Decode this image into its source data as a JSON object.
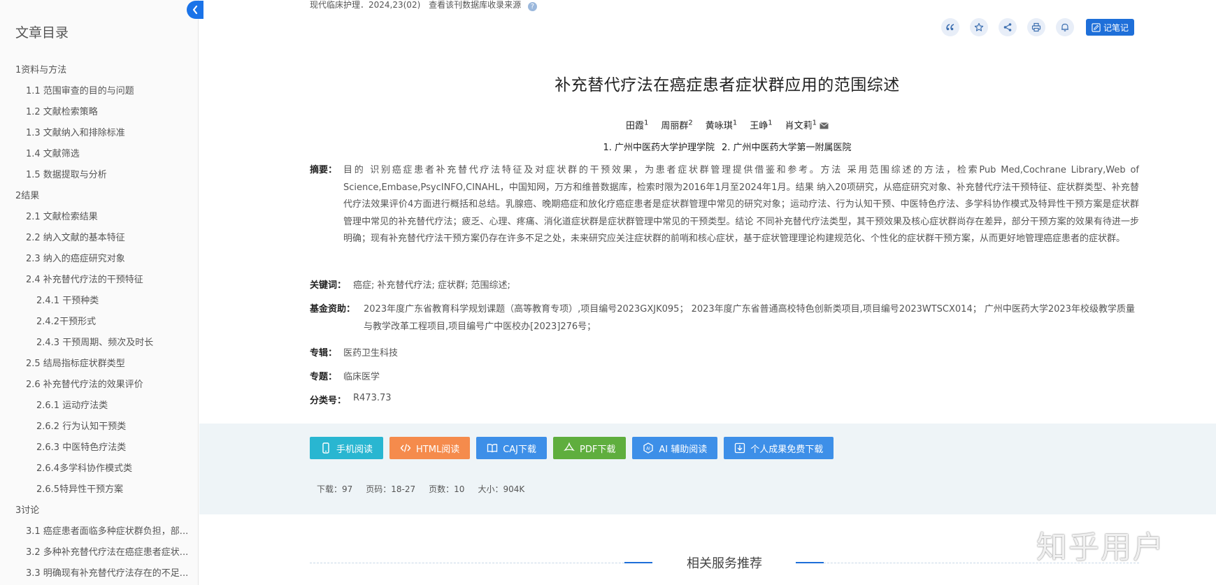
{
  "sidebar": {
    "title": "文章目录",
    "toc": [
      {
        "label": "1资料与方法",
        "level": 1
      },
      {
        "label": "1.1 范围审查的目的与问题",
        "level": 2
      },
      {
        "label": "1.2 文献检索策略",
        "level": 2
      },
      {
        "label": "1.3 文献纳入和排除标准",
        "level": 2
      },
      {
        "label": "1.4 文献筛选",
        "level": 2
      },
      {
        "label": "1.5 数据提取与分析",
        "level": 2
      },
      {
        "label": "2结果",
        "level": 1
      },
      {
        "label": "2.1 文献检索结果",
        "level": 2
      },
      {
        "label": "2.2 纳入文献的基本特征",
        "level": 2
      },
      {
        "label": "2.3 纳入的癌症研究对象",
        "level": 2
      },
      {
        "label": "2.4 补充替代疗法的干预特征",
        "level": 2
      },
      {
        "label": "2.4.1 干预种类",
        "level": 3
      },
      {
        "label": "2.4.2干预形式",
        "level": 3
      },
      {
        "label": "2.4.3 干预周期、频次及时长",
        "level": 3
      },
      {
        "label": "2.5 结局指标症状群类型",
        "level": 2
      },
      {
        "label": "2.6 补充替代疗法的效果评价",
        "level": 2
      },
      {
        "label": "2.6.1 运动疗法类",
        "level": 3
      },
      {
        "label": "2.6.2 行为认知干预类",
        "level": 3
      },
      {
        "label": "2.6.3 中医特色疗法类",
        "level": 3
      },
      {
        "label": "2.6.4多学科协作模式类",
        "level": 3
      },
      {
        "label": "2.6.5特异性干预方案",
        "level": 3
      },
      {
        "label": "3讨论",
        "level": 1
      },
      {
        "label": "3.1 癌症患者面临多种症状群负担，部...",
        "level": 2
      },
      {
        "label": "3.2 多种补充替代疗法在癌症患者症状...",
        "level": 2
      },
      {
        "label": "3.3 明确现有补充替代疗法存在的不足...",
        "level": 2
      }
    ]
  },
  "source": {
    "journal": "现代临床护理．2024,23(02)",
    "link_text": "查看该刊数据库收录来源"
  },
  "toolbar": {
    "icons": [
      "quote-icon",
      "star-icon",
      "share-icon",
      "print-icon",
      "bell-icon"
    ],
    "note_label": "记笔记"
  },
  "article": {
    "title": "补充替代疗法在癌症患者症状群应用的范围综述",
    "authors": [
      {
        "name": "田霞",
        "aff": "1"
      },
      {
        "name": "周丽群",
        "aff": "2"
      },
      {
        "name": "黄咏琪",
        "aff": "1"
      },
      {
        "name": "王峥",
        "aff": "1"
      },
      {
        "name": "肖文莉",
        "aff": "1"
      }
    ],
    "orgs": [
      "1. 广州中医药大学护理学院",
      "2. 广州中医药大学第一附属医院"
    ],
    "abstract_label": "摘要：",
    "abstract": "目的 识别癌症患者补充替代疗法特征及对症状群的干预效果，为患者症状群管理提供借鉴和参考。方法 采用范围综述的方法，检索Pub Med,Cochrane Library,Web of Science,Embase,PsycINFO,CINAHL，中国知网，万方和维普数据库，检索时限为2016年1月至2024年1月。结果 纳入20项研究，从癌症研究对象、补充替代疗法干预特征、症状群类型、补充替代疗法效果评价4方面进行概括和总结。乳腺癌、晚期癌症和放化疗癌症患者是症状群管理中常见的研究对象；运动疗法、行为认知干预、中医特色疗法、多学科协作模式及特异性干预方案是症状群管理中常见的补充替代疗法；疲乏、心理、疼痛、消化道症状群是症状群管理中常见的干预类型。结论 不同补充替代疗法类型，其干预效果及核心症状群尚存在差异，部分干预方案的效果有待进一步明确；现有补充替代疗法干预方案仍存在许多不足之处，未来研究应关注症状群的前哨和核心症状，基于症状管理理论构建规范化、个性化的症状群干预方案，从而更好地管理癌症患者的症状群。",
    "keywords_label": "关键词：",
    "keywords": "癌症;  补充替代疗法;  症状群;  范围综述;",
    "funds_label": "基金资助：",
    "funds": "2023年度广东省教育科学规划课题（高等教育专项）,项目编号2023GXJK095；  2023年度广东省普通高校特色创新类项目,项目编号2023WTSCX014；  广州中医药大学2023年校级教学质量与教学改革工程项目,项目编号广中医校办[2023]276号；",
    "album_label": "专辑：",
    "album": "医药卫生科技",
    "topic_label": "专题：",
    "topic": "临床医学",
    "classno_label": "分类号：",
    "classno": "R473.73"
  },
  "downloads": {
    "buttons": [
      {
        "label": "手机阅读",
        "icon": "phone-icon",
        "color": "#29b6d1"
      },
      {
        "label": "HTML阅读",
        "icon": "code-icon",
        "color": "#f58b4c"
      },
      {
        "label": "CAJ下载",
        "icon": "book-icon",
        "color": "#3d8fe8"
      },
      {
        "label": "PDF下载",
        "icon": "pdf-icon",
        "color": "#5fae3e"
      },
      {
        "label": "AI 辅助阅读",
        "icon": "ai-icon",
        "color": "#3d8fe8"
      },
      {
        "label": "个人成果免费下载",
        "icon": "download-icon",
        "color": "#3d8fe8"
      }
    ],
    "stats": {
      "downloads": "下载：97",
      "pages": "页码：18-27",
      "page_count": "页数：10",
      "size": "大小：904K"
    }
  },
  "related": {
    "heading": "相关服务推荐"
  },
  "watermark": "知乎用户"
}
